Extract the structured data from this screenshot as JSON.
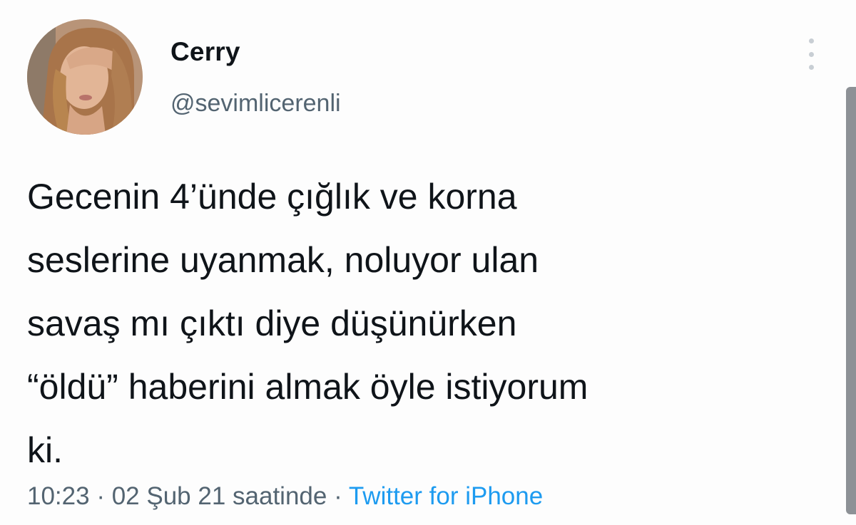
{
  "tweet": {
    "author": {
      "display_name": "Cerry",
      "handle": "@sevimlicerenli"
    },
    "text": "Gecenin 4’ünde çığlık ve korna\nseslerine uyanmak, noluyor ulan\nsavaş mı çıktı diye düşünürken\n“öldü” haberini almak öyle istiyorum\nki.",
    "time": "10:23",
    "separator": "·",
    "date": "02 Şub 21 saatinde",
    "source": "Twitter for iPhone",
    "more_icon": "more-vertical-icon"
  },
  "colors": {
    "text": "#0f1419",
    "secondary": "#536471",
    "link": "#1d9bf0"
  }
}
